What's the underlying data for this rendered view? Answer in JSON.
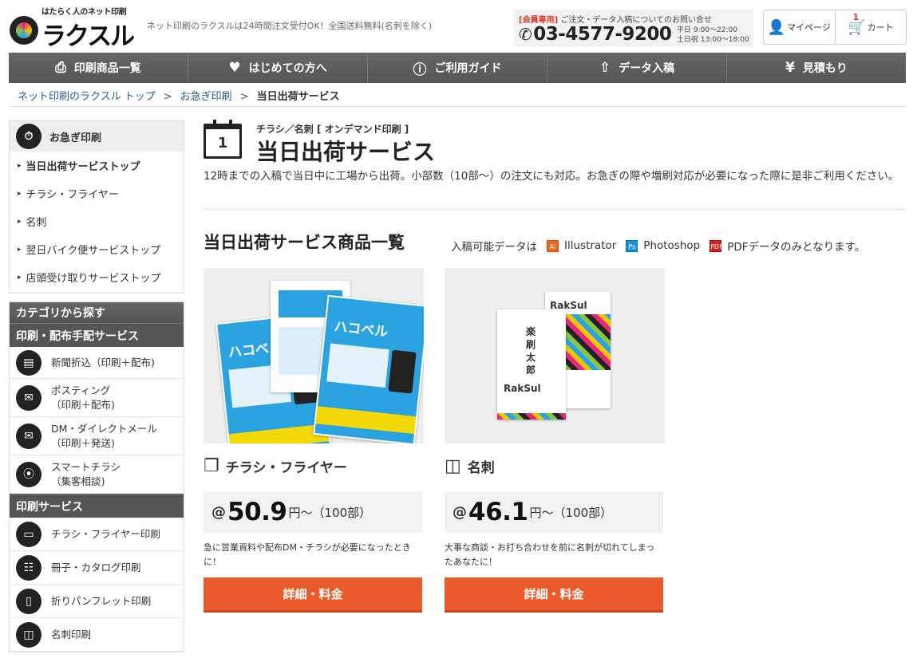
{
  "header": {
    "tagline": "はたらく人のネット印刷",
    "logo_text": "ラクスル",
    "note": "ネット印刷のラクスルは24時間注文受付OK！全国送料無料(名刺を除く)",
    "contact_member": "[会員専用]",
    "contact_text": "ご注文・データ入稿についてのお問い合せ",
    "phone": "03-4577-9200",
    "hours_weekday": "平日 9:00〜22:00",
    "hours_weekend": "土日祝 13:00〜18:00",
    "mypage": "マイページ",
    "cart": "カート",
    "cart_count": "1"
  },
  "nav": [
    {
      "label": "印刷商品一覧",
      "icon": "printer-icon"
    },
    {
      "label": "はじめての方へ",
      "icon": "heart-icon"
    },
    {
      "label": "ご利用ガイド",
      "icon": "question-icon"
    },
    {
      "label": "データ入稿",
      "icon": "upload-icon"
    },
    {
      "label": "見積もり",
      "icon": "yen-icon"
    }
  ],
  "breadcrumb": {
    "home": "ネット印刷のラクスル トップ",
    "parent": "お急ぎ印刷",
    "current": "当日出荷サービス",
    "sep": ">"
  },
  "sidebar": {
    "head": "お急ぎ印刷",
    "links": [
      "当日出荷サービストップ",
      "チラシ・フライヤー",
      "名刺",
      "翌日バイク便サービストップ",
      "店頭受け取りサービストップ"
    ],
    "category_head": "カテゴリから探す",
    "group1": "印刷・配布手配サービス",
    "group1_items": [
      {
        "l1": "新聞折込（印刷＋配布)",
        "l2": ""
      },
      {
        "l1": "ポスティング",
        "l2": "（印刷＋配布)"
      },
      {
        "l1": "DM・ダイレクトメール",
        "l2": "（印刷＋発送)"
      },
      {
        "l1": "スマートチラシ",
        "l2": "（集客相談)"
      }
    ],
    "group2": "印刷サービス",
    "group2_items": [
      "チラシ・フライヤー印刷",
      "冊子・カタログ印刷",
      "折りパンフレット印刷",
      "名刺印刷"
    ]
  },
  "main": {
    "calendar_day": "1",
    "eyebrow": "チラシ／名刺 [ オンデマンド印刷 ]",
    "title": "当日出荷サービス",
    "lead": "12時までの入稿で当日中に工場から出荷。小部数（10部〜）の注文にも対応。お急ぎの際や増刷対応が必要になった際に是非ご利用ください。",
    "section_title": "当日出荷サービス商品一覧",
    "formats_intro": "入稿可能データは",
    "format_ai": "Illustrator",
    "format_ps": "Photoshop",
    "format_pdf": "PDFデータのみとなります。",
    "ai_badge": "Ai",
    "ps_badge": "Ps",
    "pdf_badge": "PDF"
  },
  "products": [
    {
      "name": "チラシ・フライヤー",
      "price_prefix": "@",
      "price": "50.9",
      "price_unit": "円〜（100部）",
      "desc": "急に営業資料や配布DM・チラシが必要になったときに！",
      "button": "詳細・料金",
      "art_text": "ハコベル"
    },
    {
      "name": "名刺",
      "price_prefix": "@",
      "price": "46.1",
      "price_unit": "円〜（100部）",
      "desc": "大事な商談・お打ち合わせを前に名刺が切れてしまったあなたに！",
      "button": "詳細・料金",
      "art_name": "楽刷太郎",
      "art_brand": "RakSul"
    }
  ]
}
